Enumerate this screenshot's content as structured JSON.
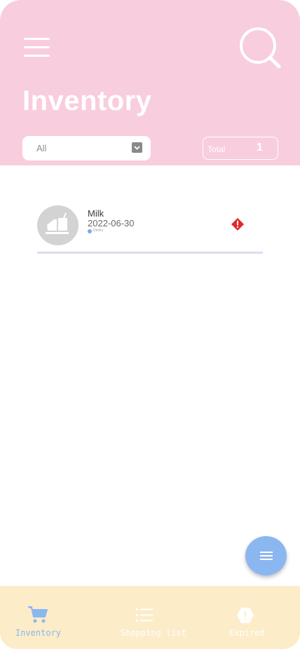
{
  "header": {
    "title": "Inventory",
    "filter": {
      "value": "All"
    },
    "total": {
      "label": "Total",
      "count": "1"
    }
  },
  "items": [
    {
      "name": "Milk",
      "date": "2022-06-30",
      "category": "Drinks",
      "status": "expired",
      "icon": "drinks-icon"
    }
  ],
  "bottom_nav": [
    {
      "label": "Inventory",
      "icon": "cart-icon",
      "active": true
    },
    {
      "label": "Shopping list",
      "icon": "list-icon",
      "active": false
    },
    {
      "label": "Expired",
      "icon": "alert-icon",
      "active": false
    }
  ],
  "colors": {
    "header": "#f8cddd",
    "accent": "#8ab7f0",
    "bottom_nav": "#fcecc8",
    "warning": "#e02a2a"
  }
}
